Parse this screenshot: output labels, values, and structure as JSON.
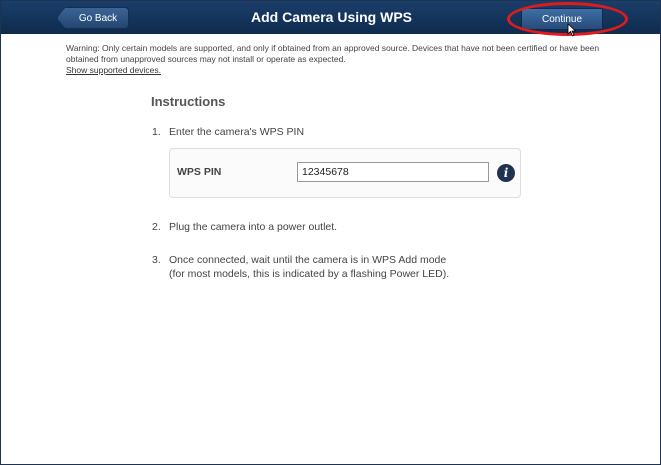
{
  "header": {
    "back_label": "Go Back",
    "title": "Add Camera Using WPS",
    "continue_label": "Continue"
  },
  "warning": {
    "text": "Warning: Only certain models are supported, and only if obtained from an approved source. Devices that have not been certified or have been obtained from unapproved sources may not install or operate as expected.",
    "link_label": "Show supported devices."
  },
  "instructions": {
    "title": "Instructions",
    "steps": [
      {
        "num": "1.",
        "text": "Enter the camera's WPS PIN"
      },
      {
        "num": "2.",
        "text": "Plug the camera into a power outlet."
      },
      {
        "num": "3.",
        "text": "Once connected, wait until the camera is in WPS Add mode",
        "text2": "(for most models, this is indicated by a flashing Power LED)."
      }
    ]
  },
  "pin": {
    "label": "WPS PIN",
    "value": "12345678"
  },
  "icons": {
    "info": "info-icon",
    "back": "back-arrow-icon",
    "cursor": "mouse-cursor-icon"
  },
  "colors": {
    "header_bg": "#12335a",
    "highlight": "#e01b1b",
    "info_icon": "#1e3350"
  }
}
